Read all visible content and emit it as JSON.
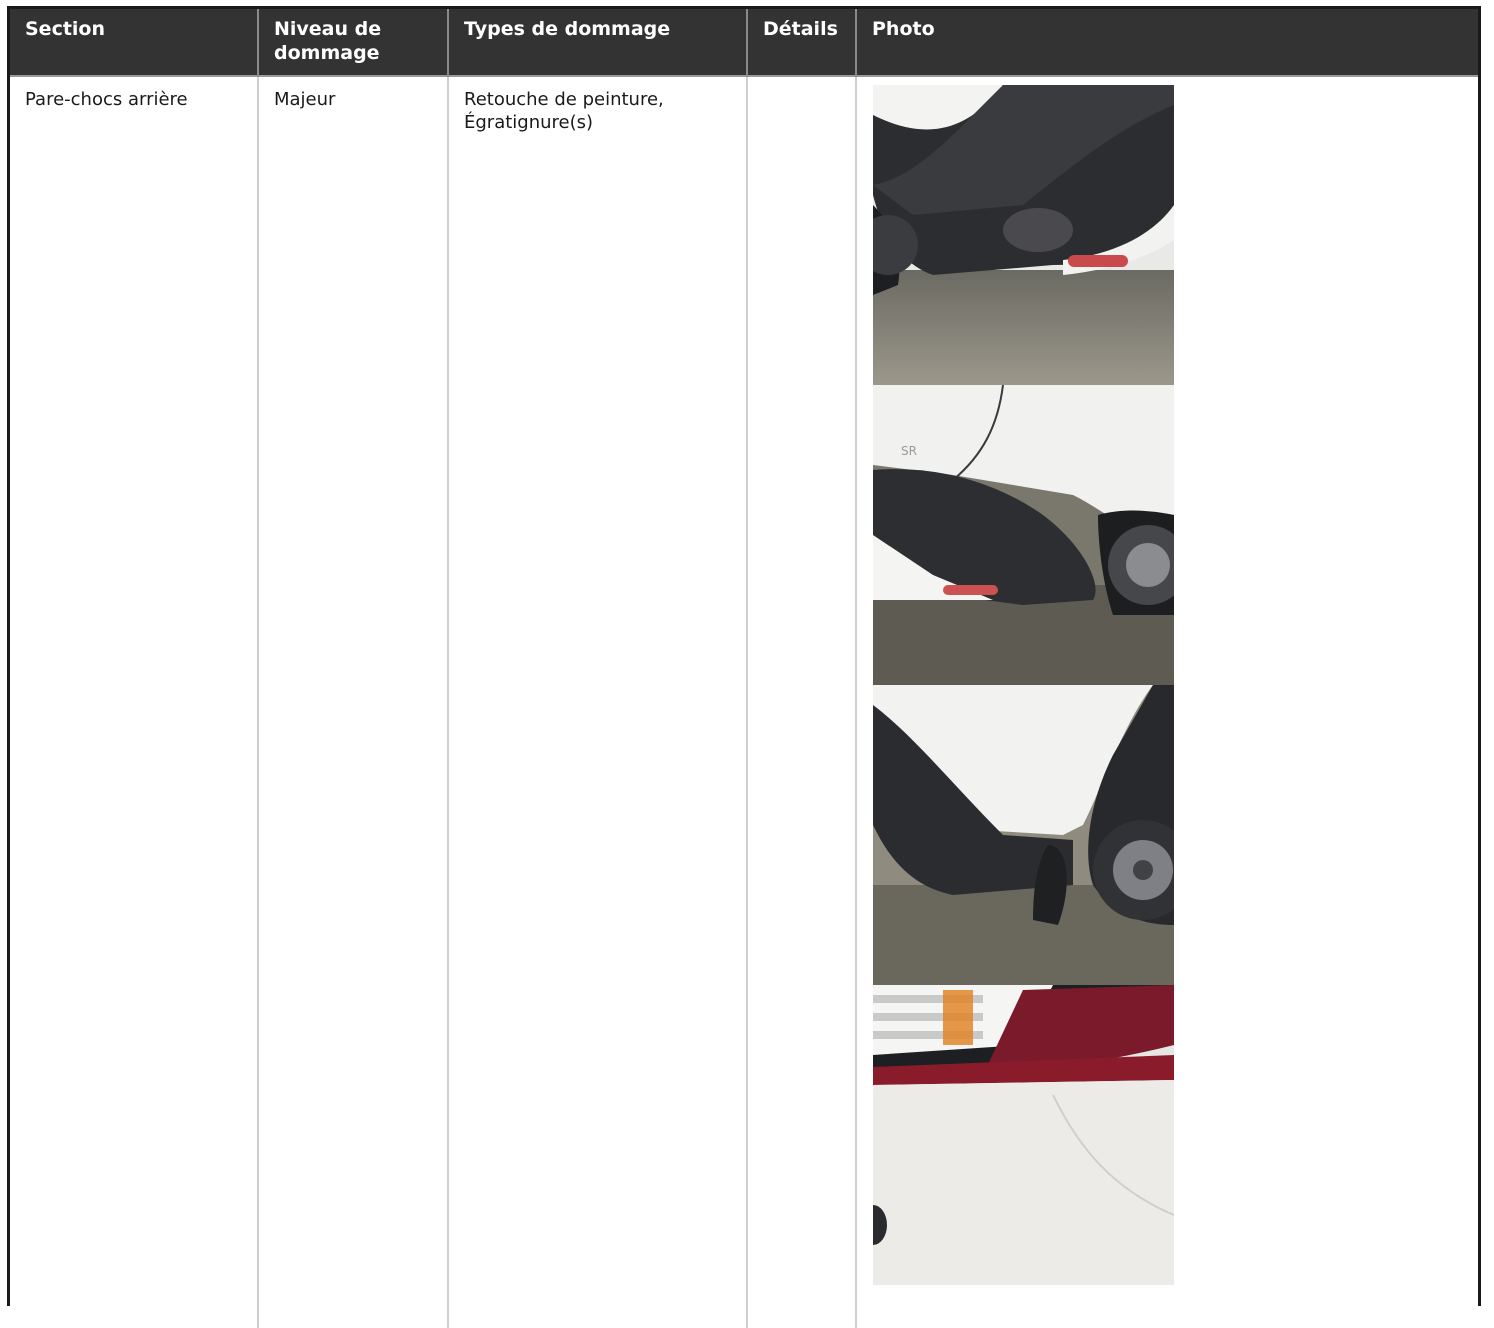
{
  "table": {
    "headers": [
      "Section",
      "Niveau de dommage",
      "Types de dommage",
      "Détails",
      "Photo"
    ],
    "rows": [
      {
        "section": "Pare-chocs arrière",
        "niveau": "Majeur",
        "types": "Retouche de peinture, Égratignure(s)",
        "details": "",
        "photos": [
          "rear-bumper-corner-photo",
          "rear-bumper-side-photo",
          "rear-wheel-arch-photo",
          "tail-light-bumper-photo"
        ]
      }
    ]
  },
  "colors": {
    "header_bg": "#333333",
    "header_text": "#ffffff",
    "body_text": "#1a1a1a",
    "border": "#1a1a1a"
  }
}
